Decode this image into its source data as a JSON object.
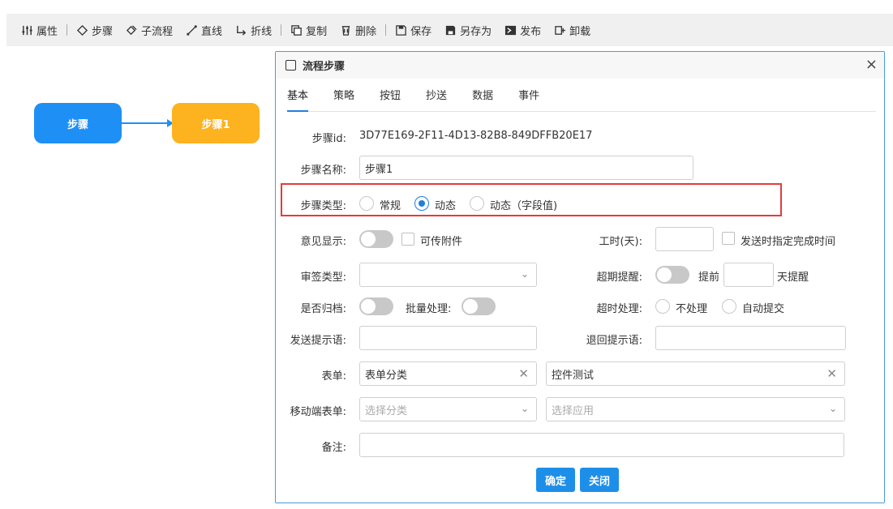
{
  "toolbar": {
    "items": [
      {
        "label": "属性",
        "icon": "sliders-icon"
      },
      {
        "label": "步骤",
        "icon": "diamond-icon"
      },
      {
        "label": "子流程",
        "icon": "subflow-icon"
      },
      {
        "label": "直线",
        "icon": "line-icon"
      },
      {
        "label": "折线",
        "icon": "polyline-icon"
      },
      {
        "label": "复制",
        "icon": "copy-icon"
      },
      {
        "label": "删除",
        "icon": "trash-icon"
      },
      {
        "label": "保存",
        "icon": "save-icon"
      },
      {
        "label": "另存为",
        "icon": "save-as-icon"
      },
      {
        "label": "发布",
        "icon": "publish-icon"
      },
      {
        "label": "卸载",
        "icon": "uninstall-icon"
      }
    ]
  },
  "canvas": {
    "node1": "步骤",
    "node2": "步骤1",
    "colors": {
      "node1": "#1e90f5",
      "node2": "#fdb21f"
    }
  },
  "dialog": {
    "title": "流程步骤",
    "close": "×",
    "tabs": [
      "基本",
      "策略",
      "按钮",
      "抄送",
      "数据",
      "事件"
    ],
    "step_id_label": "步骤id:",
    "step_id_value": "3D77E169-2F11-4D13-82B8-849DFFB20E17",
    "step_name_label": "步骤名称:",
    "step_name_value": "步骤1",
    "step_type_label": "步骤类型:",
    "step_type_options": [
      "常规",
      "动态",
      "动态（字段值)"
    ],
    "step_type_selected": "动态",
    "opinion_label": "意见显示:",
    "attach_label": "可传附件",
    "worktime_label": "工时(天):",
    "worktime_value": "",
    "send_complete_label": "发送时指定完成时间",
    "sign_type_label": "审签类型:",
    "overdue_label": "超期提醒:",
    "advance_label": "提前",
    "days_remind_label": "天提醒",
    "archive_label": "是否归档:",
    "batch_label": "批量处理:",
    "timeout_label": "超时处理:",
    "timeout_options": [
      "不处理",
      "自动提交"
    ],
    "send_prompt_label": "发送提示语:",
    "return_prompt_label": "退回提示语:",
    "form_label": "表单:",
    "form_category": "表单分类",
    "form_control": "控件测试",
    "mobile_form_label": "移动端表单:",
    "mobile_category_placeholder": "选择分类",
    "mobile_app_placeholder": "选择应用",
    "remark_label": "备注:",
    "ok_button": "确定",
    "close_button": "关闭"
  }
}
